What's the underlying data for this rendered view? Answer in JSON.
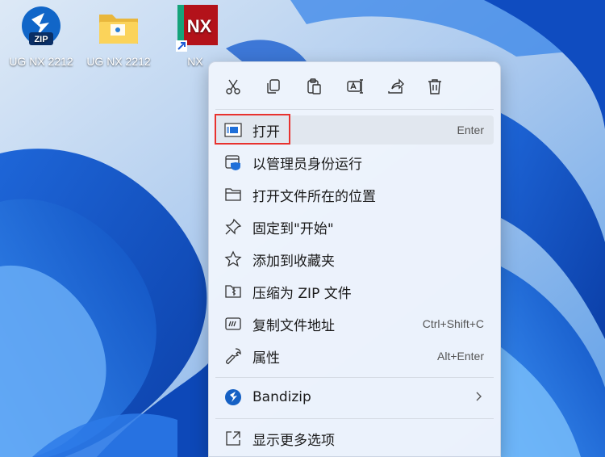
{
  "desktop": {
    "icons": [
      {
        "label": "UG NX 2212",
        "badge": "ZIP"
      },
      {
        "label": "UG NX 2212"
      },
      {
        "label": "NX",
        "badge": "NX"
      }
    ]
  },
  "context_menu": {
    "toolbar": [
      {
        "icon": "cut-icon"
      },
      {
        "icon": "copy-icon"
      },
      {
        "icon": "paste-icon"
      },
      {
        "icon": "rename-icon"
      },
      {
        "icon": "share-icon"
      },
      {
        "icon": "delete-icon"
      }
    ],
    "items": [
      {
        "label": "打开",
        "shortcut": "Enter",
        "icon": "open-app-icon",
        "highlighted": true
      },
      {
        "label": "以管理员身份运行",
        "icon": "run-as-admin-icon"
      },
      {
        "label": "打开文件所在的位置",
        "icon": "folder-icon"
      },
      {
        "label": "固定到\"开始\"",
        "icon": "pin-icon"
      },
      {
        "label": "添加到收藏夹",
        "icon": "star-icon"
      },
      {
        "label": "压缩为 ZIP 文件",
        "icon": "zip-folder-icon"
      },
      {
        "label": "复制文件地址",
        "shortcut": "Ctrl+Shift+C",
        "icon": "copy-path-icon"
      },
      {
        "label": "属性",
        "shortcut": "Alt+Enter",
        "icon": "wrench-icon"
      }
    ],
    "bandizip": {
      "label": "Bandizip",
      "icon": "bandizip-icon"
    },
    "more": {
      "label": "显示更多选项",
      "icon": "more-options-icon"
    }
  },
  "colors": {
    "wallpaper_blue": "#2f7fd6",
    "menu_bg": "#eef4fc",
    "highlight_border": "#e8322f",
    "nx_red": "#b3121a"
  }
}
